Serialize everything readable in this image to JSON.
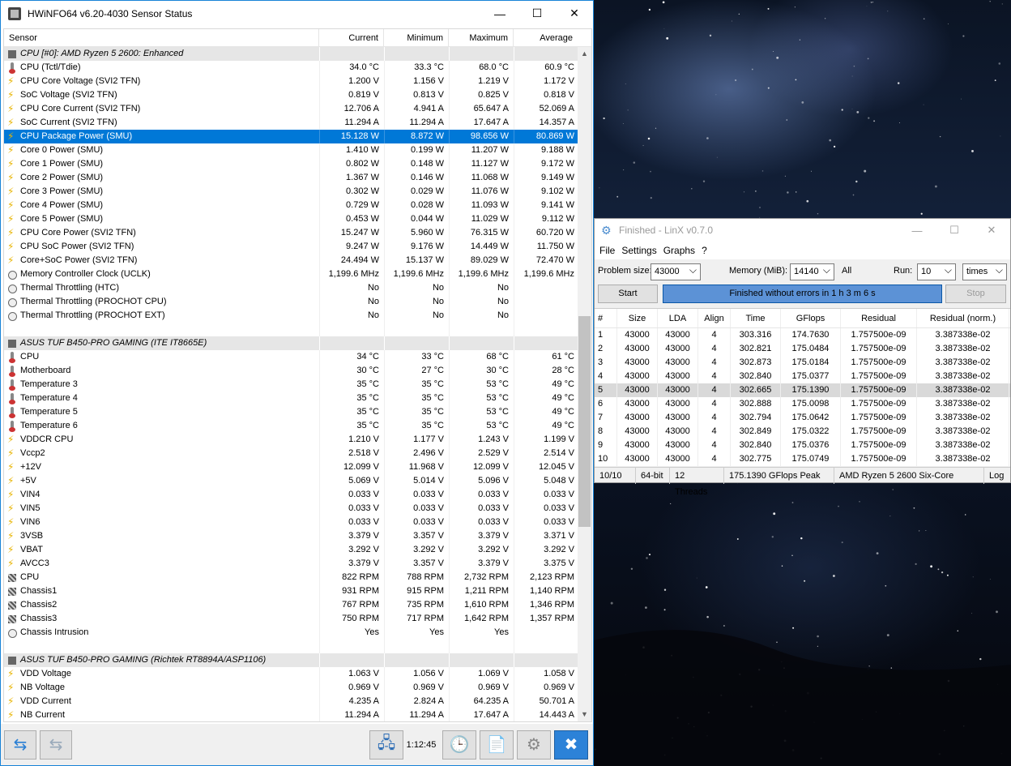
{
  "hwinfo": {
    "title": "HWiNFO64 v6.20-4030 Sensor Status",
    "columns": [
      "Sensor",
      "Current",
      "Minimum",
      "Maximum",
      "Average"
    ],
    "rows": [
      {
        "type": "sec",
        "name": "CPU [#0]: AMD Ryzen 5 2600: Enhanced",
        "icon": "c"
      },
      {
        "name": "CPU (Tctl/Tdie)",
        "icon": "t",
        "cur": "34.0 °C",
        "min": "33.3 °C",
        "max": "68.0 °C",
        "avg": "60.9 °C"
      },
      {
        "name": "CPU Core Voltage (SVI2 TFN)",
        "icon": "b",
        "cur": "1.200 V",
        "min": "1.156 V",
        "max": "1.219 V",
        "avg": "1.172 V"
      },
      {
        "name": "SoC Voltage (SVI2 TFN)",
        "icon": "b",
        "cur": "0.819 V",
        "min": "0.813 V",
        "max": "0.825 V",
        "avg": "0.818 V"
      },
      {
        "name": "CPU Core Current (SVI2 TFN)",
        "icon": "b",
        "cur": "12.706 A",
        "min": "4.941 A",
        "max": "65.647 A",
        "avg": "52.069 A"
      },
      {
        "name": "SoC Current (SVI2 TFN)",
        "icon": "b",
        "cur": "11.294 A",
        "min": "11.294 A",
        "max": "17.647 A",
        "avg": "14.357 A"
      },
      {
        "name": "CPU Package Power (SMU)",
        "icon": "b",
        "cur": "15.128 W",
        "min": "8.872 W",
        "max": "98.656 W",
        "avg": "80.869 W",
        "sel": true
      },
      {
        "name": "Core 0 Power (SMU)",
        "icon": "b",
        "cur": "1.410 W",
        "min": "0.199 W",
        "max": "11.207 W",
        "avg": "9.188 W"
      },
      {
        "name": "Core 1 Power (SMU)",
        "icon": "b",
        "cur": "0.802 W",
        "min": "0.148 W",
        "max": "11.127 W",
        "avg": "9.172 W"
      },
      {
        "name": "Core 2 Power (SMU)",
        "icon": "b",
        "cur": "1.367 W",
        "min": "0.146 W",
        "max": "11.068 W",
        "avg": "9.149 W"
      },
      {
        "name": "Core 3 Power (SMU)",
        "icon": "b",
        "cur": "0.302 W",
        "min": "0.029 W",
        "max": "11.076 W",
        "avg": "9.102 W"
      },
      {
        "name": "Core 4 Power (SMU)",
        "icon": "b",
        "cur": "0.729 W",
        "min": "0.028 W",
        "max": "11.093 W",
        "avg": "9.141 W"
      },
      {
        "name": "Core 5 Power (SMU)",
        "icon": "b",
        "cur": "0.453 W",
        "min": "0.044 W",
        "max": "11.029 W",
        "avg": "9.112 W"
      },
      {
        "name": "CPU Core Power (SVI2 TFN)",
        "icon": "b",
        "cur": "15.247 W",
        "min": "5.960 W",
        "max": "76.315 W",
        "avg": "60.720 W"
      },
      {
        "name": "CPU SoC Power (SVI2 TFN)",
        "icon": "b",
        "cur": "9.247 W",
        "min": "9.176 W",
        "max": "14.449 W",
        "avg": "11.750 W"
      },
      {
        "name": "Core+SoC Power (SVI2 TFN)",
        "icon": "b",
        "cur": "24.494 W",
        "min": "15.137 W",
        "max": "89.029 W",
        "avg": "72.470 W"
      },
      {
        "name": "Memory Controller Clock (UCLK)",
        "icon": "o",
        "cur": "1,199.6 MHz",
        "min": "1,199.6 MHz",
        "max": "1,199.6 MHz",
        "avg": "1,199.6 MHz"
      },
      {
        "name": "Thermal Throttling (HTC)",
        "icon": "o",
        "cur": "No",
        "min": "No",
        "max": "No",
        "avg": ""
      },
      {
        "name": "Thermal Throttling (PROCHOT CPU)",
        "icon": "o",
        "cur": "No",
        "min": "No",
        "max": "No",
        "avg": ""
      },
      {
        "name": "Thermal Throttling (PROCHOT EXT)",
        "icon": "o",
        "cur": "No",
        "min": "No",
        "max": "No",
        "avg": ""
      },
      {
        "type": "blank"
      },
      {
        "type": "sec",
        "name": "ASUS TUF B450-PRO GAMING (ITE IT8665E)",
        "icon": "c"
      },
      {
        "name": "CPU",
        "icon": "t",
        "cur": "34 °C",
        "min": "33 °C",
        "max": "68 °C",
        "avg": "61 °C"
      },
      {
        "name": "Motherboard",
        "icon": "t",
        "cur": "30 °C",
        "min": "27 °C",
        "max": "30 °C",
        "avg": "28 °C"
      },
      {
        "name": "Temperature 3",
        "icon": "t",
        "cur": "35 °C",
        "min": "35 °C",
        "max": "53 °C",
        "avg": "49 °C"
      },
      {
        "name": "Temperature 4",
        "icon": "t",
        "cur": "35 °C",
        "min": "35 °C",
        "max": "53 °C",
        "avg": "49 °C"
      },
      {
        "name": "Temperature 5",
        "icon": "t",
        "cur": "35 °C",
        "min": "35 °C",
        "max": "53 °C",
        "avg": "49 °C"
      },
      {
        "name": "Temperature 6",
        "icon": "t",
        "cur": "35 °C",
        "min": "35 °C",
        "max": "53 °C",
        "avg": "49 °C"
      },
      {
        "name": "VDDCR CPU",
        "icon": "b",
        "cur": "1.210 V",
        "min": "1.177 V",
        "max": "1.243 V",
        "avg": "1.199 V"
      },
      {
        "name": "Vccp2",
        "icon": "b",
        "cur": "2.518 V",
        "min": "2.496 V",
        "max": "2.529 V",
        "avg": "2.514 V"
      },
      {
        "name": "+12V",
        "icon": "b",
        "cur": "12.099 V",
        "min": "11.968 V",
        "max": "12.099 V",
        "avg": "12.045 V"
      },
      {
        "name": "+5V",
        "icon": "b",
        "cur": "5.069 V",
        "min": "5.014 V",
        "max": "5.096 V",
        "avg": "5.048 V"
      },
      {
        "name": "VIN4",
        "icon": "b",
        "cur": "0.033 V",
        "min": "0.033 V",
        "max": "0.033 V",
        "avg": "0.033 V"
      },
      {
        "name": "VIN5",
        "icon": "b",
        "cur": "0.033 V",
        "min": "0.033 V",
        "max": "0.033 V",
        "avg": "0.033 V"
      },
      {
        "name": "VIN6",
        "icon": "b",
        "cur": "0.033 V",
        "min": "0.033 V",
        "max": "0.033 V",
        "avg": "0.033 V"
      },
      {
        "name": "3VSB",
        "icon": "b",
        "cur": "3.379 V",
        "min": "3.357 V",
        "max": "3.379 V",
        "avg": "3.371 V"
      },
      {
        "name": "VBAT",
        "icon": "b",
        "cur": "3.292 V",
        "min": "3.292 V",
        "max": "3.292 V",
        "avg": "3.292 V"
      },
      {
        "name": "AVCC3",
        "icon": "b",
        "cur": "3.379 V",
        "min": "3.357 V",
        "max": "3.379 V",
        "avg": "3.375 V"
      },
      {
        "name": "CPU",
        "icon": "f",
        "cur": "822 RPM",
        "min": "788 RPM",
        "max": "2,732 RPM",
        "avg": "2,123 RPM"
      },
      {
        "name": "Chassis1",
        "icon": "f",
        "cur": "931 RPM",
        "min": "915 RPM",
        "max": "1,211 RPM",
        "avg": "1,140 RPM"
      },
      {
        "name": "Chassis2",
        "icon": "f",
        "cur": "767 RPM",
        "min": "735 RPM",
        "max": "1,610 RPM",
        "avg": "1,346 RPM"
      },
      {
        "name": "Chassis3",
        "icon": "f",
        "cur": "750 RPM",
        "min": "717 RPM",
        "max": "1,642 RPM",
        "avg": "1,357 RPM"
      },
      {
        "name": "Chassis Intrusion",
        "icon": "o",
        "cur": "Yes",
        "min": "Yes",
        "max": "Yes",
        "avg": ""
      },
      {
        "type": "blank"
      },
      {
        "type": "sec",
        "name": "ASUS TUF B450-PRO GAMING (Richtek RT8894A/ASP1106)",
        "icon": "c"
      },
      {
        "name": "VDD Voltage",
        "icon": "b",
        "cur": "1.063 V",
        "min": "1.056 V",
        "max": "1.069 V",
        "avg": "1.058 V"
      },
      {
        "name": "NB Voltage",
        "icon": "b",
        "cur": "0.969 V",
        "min": "0.969 V",
        "max": "0.969 V",
        "avg": "0.969 V"
      },
      {
        "name": "VDD Current",
        "icon": "b",
        "cur": "4.235 A",
        "min": "2.824 A",
        "max": "64.235 A",
        "avg": "50.701 A"
      },
      {
        "name": "NB Current",
        "icon": "b",
        "cur": "11.294 A",
        "min": "11.294 A",
        "max": "17.647 A",
        "avg": "14.443 A"
      }
    ],
    "elapsed": "1:12:45"
  },
  "linx": {
    "title": "Finished - LinX v0.7.0",
    "menu": [
      "File",
      "Settings",
      "Graphs",
      "?"
    ],
    "problem_size_label": "Problem size:",
    "problem_size": "43000",
    "memory_label": "Memory (MiB):",
    "memory": "14140",
    "all_label": "All",
    "run_label": "Run:",
    "run": "10",
    "run_unit": "times",
    "start": "Start",
    "stop": "Stop",
    "status": "Finished without errors in 1 h 3 m 6 s",
    "columns": [
      "#",
      "Size",
      "LDA",
      "Align",
      "Time",
      "GFlops",
      "Residual",
      "Residual (norm.)"
    ],
    "rows": [
      [
        "1",
        "43000",
        "43000",
        "4",
        "303.316",
        "174.7630",
        "1.757500e-09",
        "3.387338e-02"
      ],
      [
        "2",
        "43000",
        "43000",
        "4",
        "302.821",
        "175.0484",
        "1.757500e-09",
        "3.387338e-02"
      ],
      [
        "3",
        "43000",
        "43000",
        "4",
        "302.873",
        "175.0184",
        "1.757500e-09",
        "3.387338e-02"
      ],
      [
        "4",
        "43000",
        "43000",
        "4",
        "302.840",
        "175.0377",
        "1.757500e-09",
        "3.387338e-02"
      ],
      [
        "5",
        "43000",
        "43000",
        "4",
        "302.665",
        "175.1390",
        "1.757500e-09",
        "3.387338e-02"
      ],
      [
        "6",
        "43000",
        "43000",
        "4",
        "302.888",
        "175.0098",
        "1.757500e-09",
        "3.387338e-02"
      ],
      [
        "7",
        "43000",
        "43000",
        "4",
        "302.794",
        "175.0642",
        "1.757500e-09",
        "3.387338e-02"
      ],
      [
        "8",
        "43000",
        "43000",
        "4",
        "302.849",
        "175.0322",
        "1.757500e-09",
        "3.387338e-02"
      ],
      [
        "9",
        "43000",
        "43000",
        "4",
        "302.840",
        "175.0376",
        "1.757500e-09",
        "3.387338e-02"
      ],
      [
        "10",
        "43000",
        "43000",
        "4",
        "302.775",
        "175.0749",
        "1.757500e-09",
        "3.387338e-02"
      ]
    ],
    "highlight_row": 5,
    "status_bar": [
      "10/10",
      "64-bit",
      "12 Threads",
      "175.1390 GFlops Peak",
      "AMD Ryzen 5 2600 Six-Core",
      "Log"
    ]
  }
}
